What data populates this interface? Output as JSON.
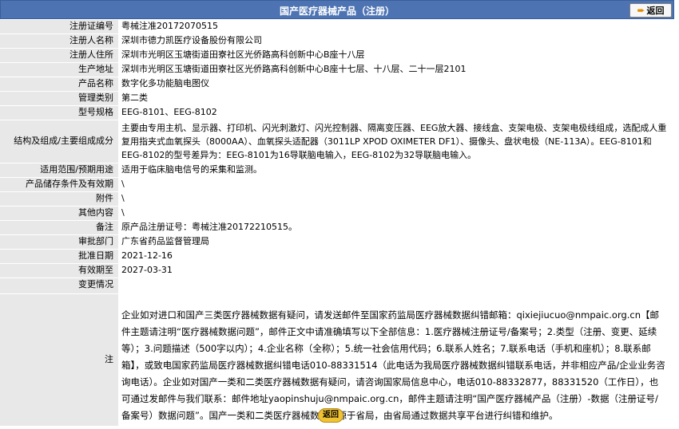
{
  "header": {
    "title": "国产医疗器械产品（注册）",
    "back_label": "返回"
  },
  "rows": [
    {
      "label": "注册证编号",
      "value": "粤械注准20172070515"
    },
    {
      "label": "注册人名称",
      "value": "深圳市德力凯医疗设备股份有限公司"
    },
    {
      "label": "注册人住所",
      "value": "深圳市光明区玉塘街道田寮社区光侨路高科创新中心B座十八层"
    },
    {
      "label": "生产地址",
      "value": "深圳市光明区玉塘街道田寮社区光侨路高科创新中心B座十七层、十八层、二十一层2101"
    },
    {
      "label": "产品名称",
      "value": "数字化多功能脑电图仪"
    },
    {
      "label": "管理类别",
      "value": "第二类"
    },
    {
      "label": "型号规格",
      "value": "EEG-8101、EEG-8102"
    },
    {
      "label": "结构及组成/主要组成成分",
      "value": "主要由专用主机、显示器、打印机、闪光刺激灯、闪光控制器、隔离变压器、EEG放大器、接线盒、支架电极、支架电极线组成，选配成人重复用指夹式血氧探头（8000AA）、血氧探头适配器（3011LP XPOD OXIMETER DF1）、摄像头、盘状电极（NE-113A）。EEG-8101和EEG-8102的型号差异为：EEG-8101为16导联脑电输入，EEG-8102为32导联脑电输入。"
    },
    {
      "label": "适用范围/预期用途",
      "value": "适用于临床脑电信号的采集和监测。"
    },
    {
      "label": "产品储存条件及有效期",
      "value": "\\"
    },
    {
      "label": "附件",
      "value": "\\"
    },
    {
      "label": "其他内容",
      "value": "\\"
    },
    {
      "label": "备注",
      "value": "原产品注册证号：粤械注准20172210515。"
    },
    {
      "label": "审批部门",
      "value": "广东省药品监督管理局"
    },
    {
      "label": "批准日期",
      "value": "2021-12-16"
    },
    {
      "label": "有效期至",
      "value": "2027-03-31"
    },
    {
      "label": "变更情况",
      "value": ""
    },
    {
      "label": "注",
      "value": "企业如对进口和国产三类医疗器械数据有疑问，请发送邮件至国家药监局医疗器械数据纠错邮箱：qixiejiucuo@nmpaic.org.cn【邮件主题请注明“医疗器械数据问题”，邮件正文中请准确填写以下全部信息：1.医疗器械注册证号/备案号；2.类型（注册、变更、延续等）；3.问题描述（500字以内）；4.企业名称（全称）；5.统一社会信用代码；6.联系人姓名；7.联系电话（手机和座机）；8.联系邮箱】，或致电国家药监局医疗器械数据纠错电话010-88331514（此电话为我局医疗器械数据纠错联系电话，并非相应产品/企业业务咨询电话）。企业如对国产一类和二类医疗器械数据有疑问，请咨询国家局信息中心，电话010-88332877，88331520（工作日），也可通过发邮件与我们联系：邮件地址yaopinshuju@nmpaic.org.cn，邮件主题请注明“国产医疗器械产品（注册）-数据（注册证号/备案号）数据问题”。国产一类和二类医疗器械数据来源于省局，由省局通过数据共享平台进行纠错和维护。"
    }
  ],
  "footer": {
    "back_label": "返回"
  },
  "colors": {
    "header_bg": "#4d73b3",
    "label_bg": "#e8e8e8",
    "back_button_bg": "#f1c232"
  }
}
